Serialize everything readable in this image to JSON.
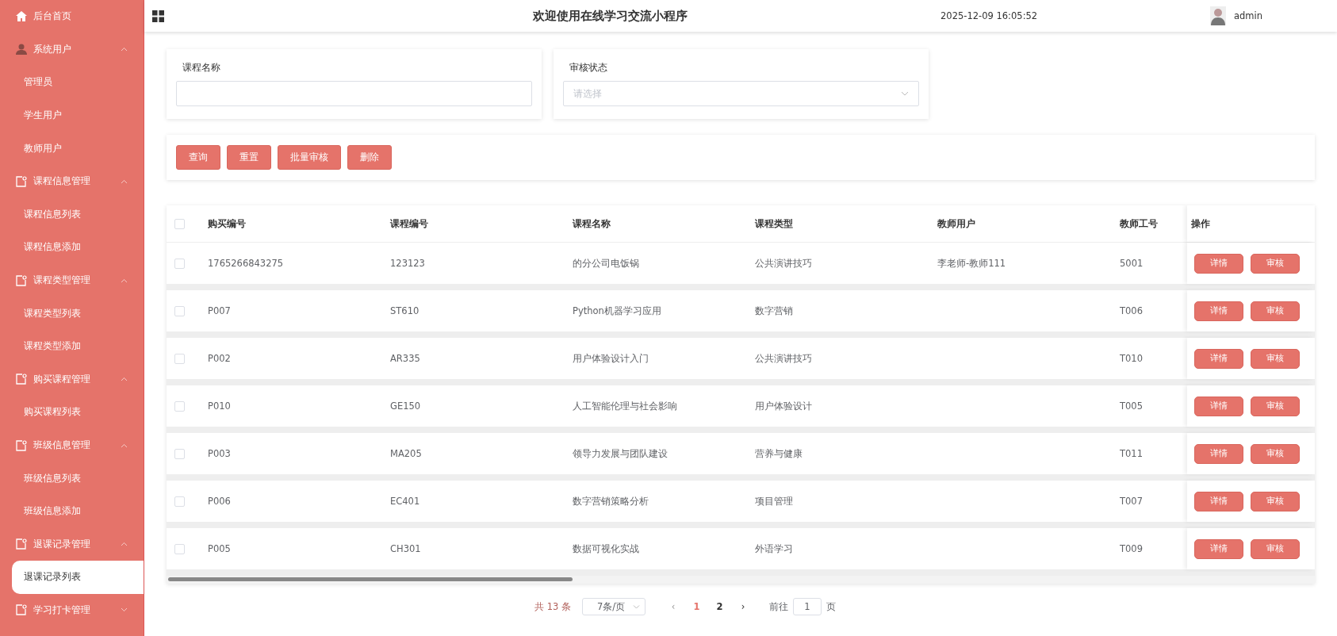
{
  "sidebar": {
    "items": [
      {
        "label": "后台首页",
        "kind": "home",
        "selected": false
      },
      {
        "label": "系统用户",
        "kind": "user-group",
        "expanded": true,
        "children": [
          {
            "label": "管理员",
            "selected": false
          },
          {
            "label": "学生用户",
            "selected": false
          },
          {
            "label": "教师用户",
            "selected": false
          }
        ]
      },
      {
        "label": "课程信息管理",
        "kind": "group",
        "expanded": true,
        "children": [
          {
            "label": "课程信息列表",
            "selected": false
          },
          {
            "label": "课程信息添加",
            "selected": false
          }
        ]
      },
      {
        "label": "课程类型管理",
        "kind": "group",
        "expanded": true,
        "children": [
          {
            "label": "课程类型列表",
            "selected": false
          },
          {
            "label": "课程类型添加",
            "selected": false
          }
        ]
      },
      {
        "label": "购买课程管理",
        "kind": "group",
        "expanded": true,
        "children": [
          {
            "label": "购买课程列表",
            "selected": false
          }
        ]
      },
      {
        "label": "班级信息管理",
        "kind": "group",
        "expanded": true,
        "children": [
          {
            "label": "班级信息列表",
            "selected": false
          },
          {
            "label": "班级信息添加",
            "selected": false
          }
        ]
      },
      {
        "label": "退课记录管理",
        "kind": "group",
        "expanded": true,
        "children": [
          {
            "label": "退课记录列表",
            "selected": true
          }
        ]
      },
      {
        "label": "学习打卡管理",
        "kind": "group",
        "expanded": false
      }
    ]
  },
  "header": {
    "title": "欢迎使用在线学习交流小程序",
    "datetime": "2025-12-09 16:05:52",
    "user": "admin"
  },
  "filters": [
    {
      "label": "课程名称",
      "kind": "text"
    },
    {
      "label": "审核状态",
      "kind": "select",
      "placeholder": "请选择"
    }
  ],
  "actions": [
    "查询",
    "重置",
    "批量审核",
    "删除"
  ],
  "table": {
    "header_checked": false,
    "columns": [
      "购买编号",
      "课程编号",
      "课程名称",
      "课程类型",
      "教师用户",
      "教师工号",
      "操作"
    ],
    "rows": [
      {
        "checked": false,
        "cells": [
          "1765266843275",
          "123123",
          "的分公司电饭锅",
          "公共演讲技巧",
          "李老师-教师111",
          "5001"
        ],
        "buttons": [
          "详情",
          "审核"
        ]
      },
      {
        "checked": false,
        "cells": [
          "P007",
          "ST610",
          "Python机器学习应用",
          "数字营销",
          "",
          "T006"
        ],
        "buttons": [
          "详情",
          "审核"
        ]
      },
      {
        "checked": false,
        "cells": [
          "P002",
          "AR335",
          "用户体验设计入门",
          "公共演讲技巧",
          "",
          "T010"
        ],
        "buttons": [
          "详情",
          "审核"
        ]
      },
      {
        "checked": false,
        "cells": [
          "P010",
          "GE150",
          "人工智能伦理与社会影响",
          "用户体验设计",
          "",
          "T005"
        ],
        "buttons": [
          "详情",
          "审核"
        ]
      },
      {
        "checked": false,
        "cells": [
          "P003",
          "MA205",
          "领导力发展与团队建设",
          "营养与健康",
          "",
          "T011"
        ],
        "buttons": [
          "详情",
          "审核"
        ]
      },
      {
        "checked": false,
        "cells": [
          "P006",
          "EC401",
          "数字营销策略分析",
          "项目管理",
          "",
          "T007"
        ],
        "buttons": [
          "详情",
          "审核"
        ]
      },
      {
        "checked": false,
        "cells": [
          "P005",
          "CH301",
          "数据可视化实战",
          "外语学习",
          "",
          "T009"
        ],
        "buttons": [
          "详情",
          "审核"
        ]
      }
    ]
  },
  "pagination": {
    "total": "共 13 条",
    "page_size": "7条/页",
    "prev": "‹",
    "pages": [
      {
        "label": "1",
        "selected": true
      },
      {
        "label": "2",
        "selected": false
      }
    ],
    "next": "›",
    "goto_label": "前往",
    "goto_value": "1",
    "goto_suffix": "页"
  }
}
